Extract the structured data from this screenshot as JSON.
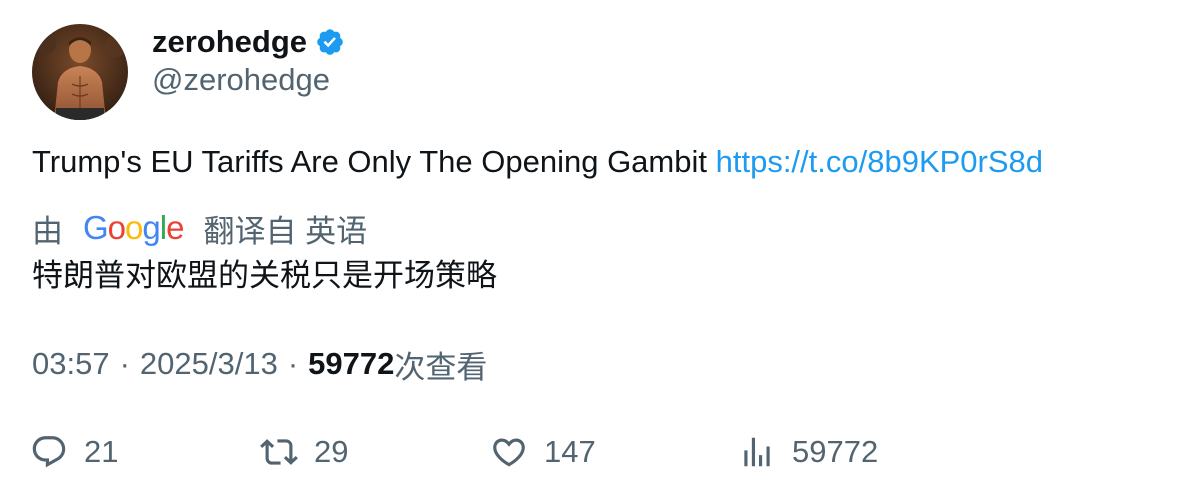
{
  "author": {
    "display_name": "zerohedge",
    "handle": "@zerohedge",
    "verified": true,
    "verified_color": "#1d9bf0"
  },
  "tweet": {
    "text": "Trump's EU Tariffs Are Only The Opening Gambit ",
    "link": "https://t.co/8b9KP0rS8d",
    "link_color": "#1d9bf0"
  },
  "translation": {
    "prefix": "由",
    "provider": "Google",
    "suffix": "翻译自 英语",
    "text": "特朗普对欧盟的关税只是开场策略"
  },
  "meta": {
    "time": "03:57",
    "separator": "·",
    "date": "2025/3/13",
    "views_count": "59772",
    "views_label": "次查看"
  },
  "actions": {
    "replies": "21",
    "retweets": "29",
    "likes": "147",
    "views": "59772"
  },
  "icons": {
    "reply": "reply-icon",
    "retweet": "retweet-icon",
    "like": "heart-icon",
    "views": "analytics-icon",
    "verified": "verified-badge-icon"
  },
  "colors": {
    "text": "#0f1419",
    "secondary": "#536471",
    "accent": "#1d9bf0"
  }
}
